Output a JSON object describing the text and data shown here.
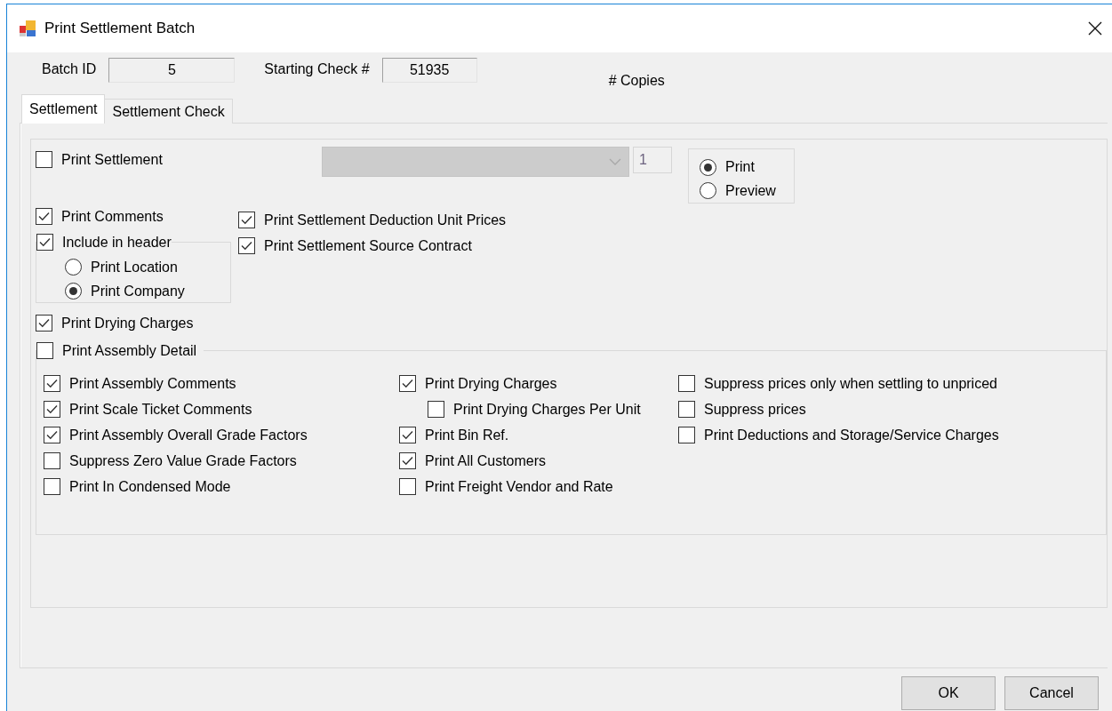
{
  "window": {
    "title": "Print Settlement Batch"
  },
  "header": {
    "batch_id": {
      "label": "Batch ID",
      "value": "5"
    },
    "starting_check": {
      "label": "Starting Check #",
      "value": "51935"
    },
    "copies_label": "# Copies"
  },
  "tabs": [
    {
      "label": "Settlement",
      "selected": true
    },
    {
      "label": "Settlement Check",
      "selected": false
    }
  ],
  "print_settlement": {
    "label": "Print Settlement",
    "checked": false,
    "report": {
      "disabled": true
    },
    "copies": {
      "value": "1",
      "disabled": true
    }
  },
  "output": [
    {
      "label": "Print",
      "selected": true
    },
    {
      "label": "Preview",
      "selected": false
    }
  ],
  "print_comments": {
    "label": "Print Comments",
    "checked": true
  },
  "include_in_header": {
    "label": "Include in header",
    "checked": true,
    "options": [
      {
        "label": "Print Location",
        "selected": false
      },
      {
        "label": "Print Company",
        "selected": true
      }
    ]
  },
  "right_options": [
    {
      "label": "Print Settlement Deduction Unit Prices",
      "checked": true
    },
    {
      "label": "Print Settlement Source Contract",
      "checked": true
    }
  ],
  "print_drying_charges": {
    "label": "Print Drying Charges",
    "checked": true
  },
  "assembly_detail": {
    "label": "Print Assembly Detail",
    "checked": false,
    "columns": [
      [
        {
          "label": "Print Assembly Comments",
          "checked": true
        },
        {
          "label": "Print Scale Ticket Comments",
          "checked": true
        },
        {
          "label": "Print Assembly Overall Grade Factors",
          "checked": true
        },
        {
          "label": "Suppress Zero Value Grade Factors",
          "checked": false
        },
        {
          "label": "Print In Condensed Mode",
          "checked": false
        }
      ],
      [
        {
          "label": "Print Drying Charges",
          "checked": true,
          "children": [
            {
              "label": "Print Drying Charges Per Unit",
              "checked": false
            }
          ]
        },
        {
          "label": "Print Bin Ref.",
          "checked": true
        },
        {
          "label": "Print All Customers",
          "checked": true
        },
        {
          "label": "Print Freight Vendor and Rate",
          "checked": false
        }
      ],
      [
        {
          "label": "Suppress prices only when settling to unpriced",
          "checked": false
        },
        {
          "label": "Suppress prices",
          "checked": false
        },
        {
          "label": "Print Deductions and Storage/Service Charges",
          "checked": false
        }
      ]
    ]
  },
  "buttons": [
    {
      "label": "OK"
    },
    {
      "label": "Cancel"
    }
  ]
}
